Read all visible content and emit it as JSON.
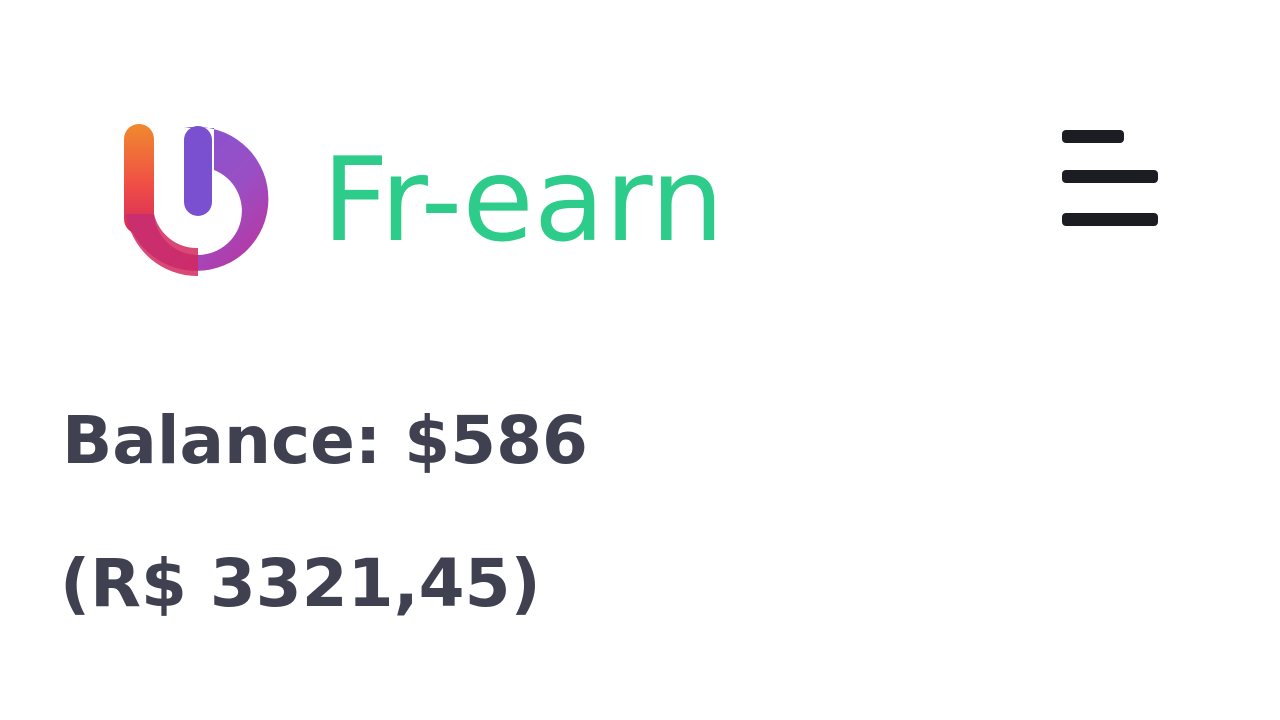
{
  "colors": {
    "brand_green": "#2ecc8a",
    "text_dark": "#3f4150",
    "menu_dark": "#1c1d22",
    "background": "#ffffff"
  },
  "header": {
    "logo_icon": "fr-earn-logo-icon",
    "brand_name": "Fr-earn",
    "menu_icon": "hamburger-menu-icon"
  },
  "account": {
    "balance_text": "Balance: $586",
    "balance_local_text": "(R$ 3321,45)"
  }
}
